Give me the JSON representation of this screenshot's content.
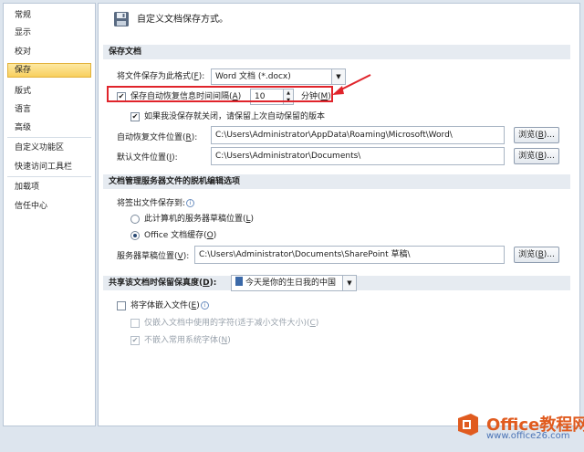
{
  "sidebar": {
    "items": [
      {
        "label": "常规"
      },
      {
        "label": "显示"
      },
      {
        "label": "校对"
      },
      {
        "label": "保存"
      },
      {
        "label": "版式"
      },
      {
        "label": "语言"
      },
      {
        "label": "高级"
      },
      {
        "label": "自定义功能区"
      },
      {
        "label": "快速访问工具栏"
      },
      {
        "label": "加载项"
      },
      {
        "label": "信任中心"
      }
    ],
    "active": "保存"
  },
  "header": {
    "title": "自定义文档保存方式。",
    "icon": "save-disk-icon"
  },
  "save_docs": {
    "section_title": "保存文档",
    "format_label": "将文件保存为此格式(",
    "format_key": "F",
    "format_value": "Word 文档 (*.docx)",
    "autorecover_label": "保存自动恢复信息时间间隔(",
    "autorecover_key": "A",
    "autorecover_checked": true,
    "autorecover_minutes": "10",
    "minutes_label": "分钟(",
    "minutes_key": "M",
    "keep_last_label": "如果我没保存就关闭，请保留上次自动保留的版本",
    "keep_last_checked": true,
    "autorecover_location_label": "自动恢复文件位置(",
    "autorecover_location_key": "R",
    "autorecover_location_value": "C:\\Users\\Administrator\\AppData\\Roaming\\Microsoft\\Word\\",
    "default_location_label": "默认文件位置(",
    "default_location_key": "I",
    "default_location_value": "C:\\Users\\Administrator\\Documents\\",
    "browse_label": "浏览(",
    "browse_key_1": "B",
    "browse_key_2": "B"
  },
  "offline_edit": {
    "section_title": "文档管理服务器文件的脱机编辑选项",
    "checkout_label": "将签出文件保存到:",
    "option_server_label": "此计算机的服务器草稿位置(",
    "option_server_key": "L",
    "option_office_label": "Office 文档缓存(",
    "option_office_key": "O",
    "selected": "office",
    "drafts_label": "服务器草稿位置(",
    "drafts_key": "V",
    "drafts_value": "C:\\Users\\Administrator\\Documents\\SharePoint 草稿\\",
    "browse_label": "浏览(",
    "browse_key": "B"
  },
  "fidelity": {
    "section_title": "共享该文档时保留保真度(",
    "section_key": "D",
    "document_value": "今天是你的生日我的中国",
    "embed_fonts_label": "将字体嵌入文件(",
    "embed_fonts_key": "E",
    "embed_fonts_checked": false,
    "embed_used_only_label": "仅嵌入文档中使用的字符(适于减小文件大小)(",
    "embed_used_only_key": "C",
    "no_system_fonts_label": "不嵌入常用系统字体(",
    "no_system_fonts_key": "N",
    "no_system_fonts_checked": true
  },
  "watermark": {
    "brand": "Office教程网",
    "url": "www.office26.com"
  },
  "colors": {
    "highlight": "#e0242b",
    "accent": "#f8cf5e",
    "brand": "#e05b1f"
  }
}
